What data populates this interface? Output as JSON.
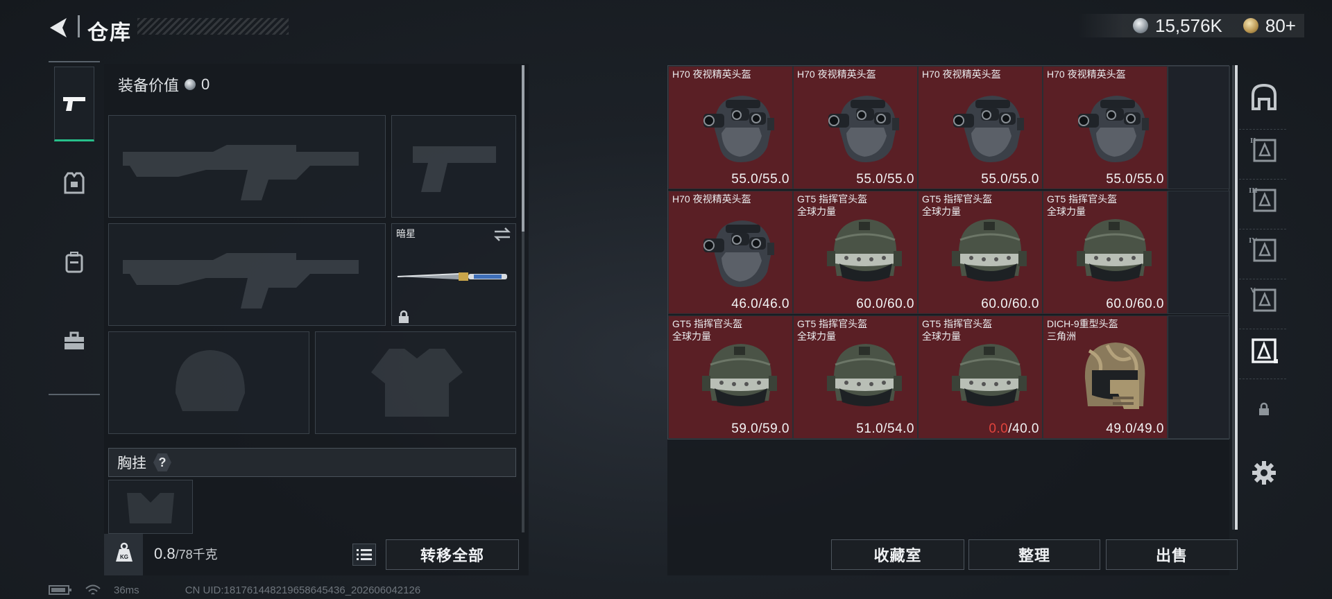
{
  "header": {
    "title": "仓库",
    "currency_silver": "15,576K",
    "currency_gold": "80+"
  },
  "equipment": {
    "value_label": "装备价值",
    "value": "0",
    "melee_name": "暗星",
    "chest_label": "胸挂",
    "help": "?"
  },
  "footer_left": {
    "weight_value": "0.8",
    "weight_capacity": "/78千克",
    "transfer_all": "转移全部"
  },
  "stash": {
    "items": [
      {
        "name": "H70 夜视精英头盔",
        "sub": "",
        "cur": "55.0",
        "max": "/55.0",
        "type": "h70"
      },
      {
        "name": "H70 夜视精英头盔",
        "sub": "",
        "cur": "55.0",
        "max": "/55.0",
        "type": "h70"
      },
      {
        "name": "H70 夜视精英头盔",
        "sub": "",
        "cur": "55.0",
        "max": "/55.0",
        "type": "h70"
      },
      {
        "name": "H70 夜视精英头盔",
        "sub": "",
        "cur": "55.0",
        "max": "/55.0",
        "type": "h70"
      },
      {
        "name": "H70 夜视精英头盔",
        "sub": "",
        "cur": "46.0",
        "max": "/46.0",
        "type": "h70"
      },
      {
        "name": "GT5 指挥官头盔",
        "sub": "全球力量",
        "cur": "60.0",
        "max": "/60.0",
        "type": "gt5"
      },
      {
        "name": "GT5 指挥官头盔",
        "sub": "全球力量",
        "cur": "60.0",
        "max": "/60.0",
        "type": "gt5"
      },
      {
        "name": "GT5 指挥官头盔",
        "sub": "全球力量",
        "cur": "60.0",
        "max": "/60.0",
        "type": "gt5"
      },
      {
        "name": "GT5 指挥官头盔",
        "sub": "全球力量",
        "cur": "59.0",
        "max": "/59.0",
        "type": "gt5"
      },
      {
        "name": "GT5 指挥官头盔",
        "sub": "全球力量",
        "cur": "51.0",
        "max": "/54.0",
        "type": "gt5"
      },
      {
        "name": "GT5 指挥官头盔",
        "sub": "全球力量",
        "cur": "0.0",
        "max": "/40.0",
        "type": "gt5"
      },
      {
        "name": "DICH-9重型头盔",
        "sub": "三角洲",
        "cur": "49.0",
        "max": "/49.0",
        "type": "dich"
      }
    ],
    "buttons": {
      "collection": "收藏室",
      "sort": "整理",
      "sell": "出售"
    }
  },
  "rail": {
    "tabs": [
      "II",
      "III",
      "IV",
      "V"
    ]
  },
  "status_bar": {
    "ping": "36ms",
    "uid": "CN UID:18176144821965864543​6_202606042126"
  }
}
